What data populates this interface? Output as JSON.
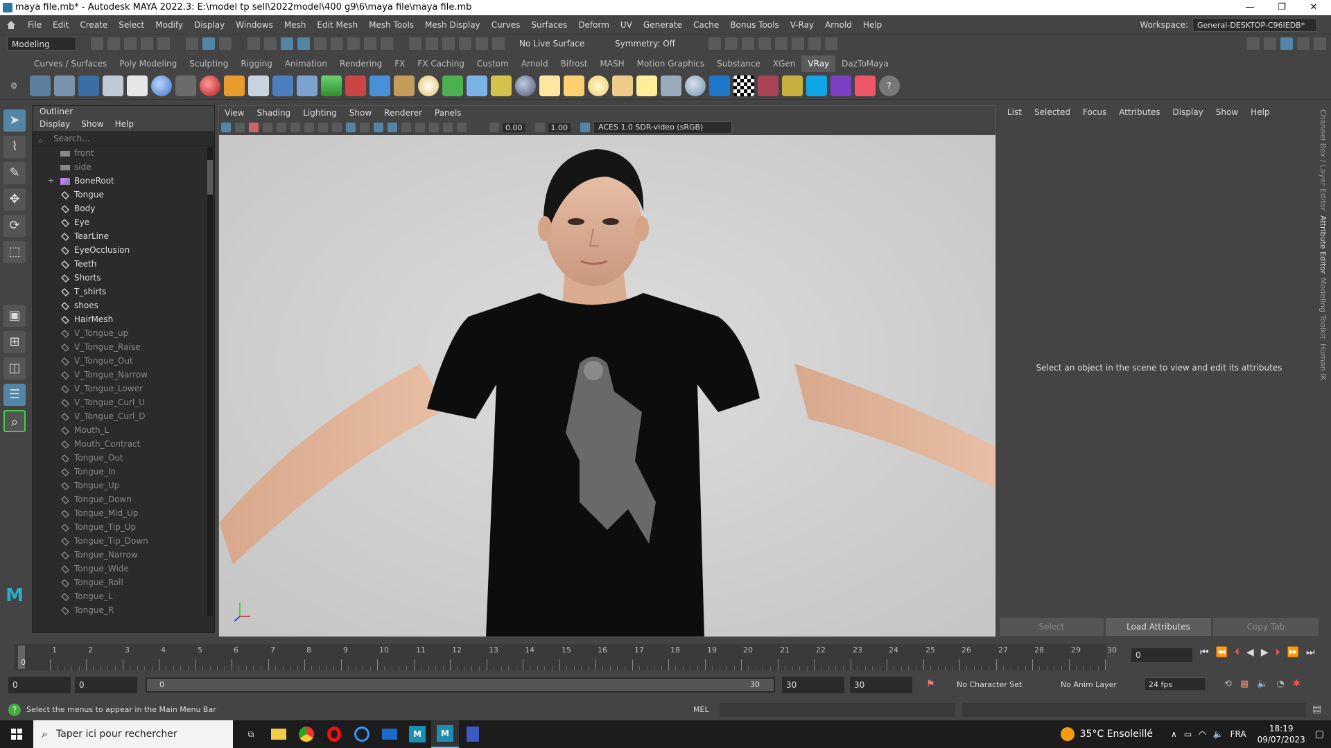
{
  "window": {
    "title": "maya file.mb* - Autodesk MAYA 2022.3: E:\\model tp sell\\2022model\\400 g9\\6\\maya file\\maya file.mb",
    "min": "—",
    "max": "❐",
    "close": "✕"
  },
  "menubar": {
    "items": [
      "File",
      "Edit",
      "Create",
      "Select",
      "Modify",
      "Display",
      "Windows",
      "Mesh",
      "Edit Mesh",
      "Mesh Tools",
      "Mesh Display",
      "Curves",
      "Surfaces",
      "Deform",
      "UV",
      "Generate",
      "Cache",
      "Bonus Tools",
      "V-Ray",
      "Arnold",
      "Help"
    ],
    "workspace_label": "Workspace:",
    "workspace_value": "General-DESKTOP-C96IEDB*"
  },
  "statusline": {
    "mode": "Modeling",
    "live_surface": "No Live Surface",
    "symmetry": "Symmetry: Off"
  },
  "shelf": {
    "tabs": [
      "Curves / Surfaces",
      "Poly Modeling",
      "Sculpting",
      "Rigging",
      "Animation",
      "Rendering",
      "FX",
      "FX Caching",
      "Custom",
      "Arnold",
      "Bifrost",
      "MASH",
      "Motion Graphics",
      "Substance",
      "XGen",
      "VRay",
      "DazToMaya"
    ],
    "active": "VRay"
  },
  "outliner": {
    "title": "Outliner",
    "menu": [
      "Display",
      "Show",
      "Help"
    ],
    "search_placeholder": "Search...",
    "items": [
      {
        "label": "front",
        "state": "off",
        "icon": "camera"
      },
      {
        "label": "side",
        "state": "off",
        "icon": "camera"
      },
      {
        "label": "BoneRoot",
        "state": "on",
        "icon": "joint",
        "expand": "+"
      },
      {
        "label": "Tongue",
        "state": "on",
        "icon": "mesh"
      },
      {
        "label": "Body",
        "state": "on",
        "icon": "mesh"
      },
      {
        "label": "Eye",
        "state": "on",
        "icon": "mesh"
      },
      {
        "label": "TearLine",
        "state": "on",
        "icon": "mesh"
      },
      {
        "label": "EyeOcclusion",
        "state": "on",
        "icon": "mesh"
      },
      {
        "label": "Teeth",
        "state": "on",
        "icon": "mesh"
      },
      {
        "label": "Shorts",
        "state": "on",
        "icon": "mesh"
      },
      {
        "label": "T_shirts",
        "state": "on",
        "icon": "mesh"
      },
      {
        "label": "shoes",
        "state": "on",
        "icon": "mesh"
      },
      {
        "label": "HairMesh",
        "state": "on",
        "icon": "mesh"
      },
      {
        "label": "V_Tongue_up",
        "state": "off",
        "icon": "mesh"
      },
      {
        "label": "V_Tongue_Raise",
        "state": "off",
        "icon": "mesh"
      },
      {
        "label": "V_Tongue_Out",
        "state": "off",
        "icon": "mesh"
      },
      {
        "label": "V_Tongue_Narrow",
        "state": "off",
        "icon": "mesh"
      },
      {
        "label": "V_Tongue_Lower",
        "state": "off",
        "icon": "mesh"
      },
      {
        "label": "V_Tongue_Curl_U",
        "state": "off",
        "icon": "mesh"
      },
      {
        "label": "V_Tongue_Curl_D",
        "state": "off",
        "icon": "mesh"
      },
      {
        "label": "Mouth_L",
        "state": "off",
        "icon": "mesh"
      },
      {
        "label": "Mouth_Contract",
        "state": "off",
        "icon": "mesh"
      },
      {
        "label": "Tongue_Out",
        "state": "off",
        "icon": "mesh"
      },
      {
        "label": "Tongue_In",
        "state": "off",
        "icon": "mesh"
      },
      {
        "label": "Tongue_Up",
        "state": "off",
        "icon": "mesh"
      },
      {
        "label": "Tongue_Down",
        "state": "off",
        "icon": "mesh"
      },
      {
        "label": "Tongue_Mid_Up",
        "state": "off",
        "icon": "mesh"
      },
      {
        "label": "Tongue_Tip_Up",
        "state": "off",
        "icon": "mesh"
      },
      {
        "label": "Tongue_Tip_Down",
        "state": "off",
        "icon": "mesh"
      },
      {
        "label": "Tongue_Narrow",
        "state": "off",
        "icon": "mesh"
      },
      {
        "label": "Tongue_Wide",
        "state": "off",
        "icon": "mesh"
      },
      {
        "label": "Tongue_Roll",
        "state": "off",
        "icon": "mesh"
      },
      {
        "label": "Tongue_L",
        "state": "off",
        "icon": "mesh"
      },
      {
        "label": "Tongue_R",
        "state": "off",
        "icon": "mesh"
      }
    ]
  },
  "viewport": {
    "menu": [
      "View",
      "Shading",
      "Lighting",
      "Show",
      "Renderer",
      "Panels"
    ],
    "exposure": "0.00",
    "gamma": "1.00",
    "colorspace": "ACES 1.0 SDR-video (sRGB)"
  },
  "attribute_editor": {
    "menu": [
      "List",
      "Selected",
      "Focus",
      "Attributes",
      "Display",
      "Show",
      "Help"
    ],
    "message": "Select an object in the scene to view and edit its attributes",
    "buttons": [
      "Select",
      "Load Attributes",
      "Copy Tab"
    ]
  },
  "side_tabs": [
    "Channel Box / Layer Editor",
    "Attribute Editor",
    "Modeling Toolkit",
    "Human IK"
  ],
  "timeline": {
    "ticks": [
      "1",
      "2",
      "3",
      "4",
      "5",
      "6",
      "7",
      "8",
      "9",
      "10",
      "11",
      "12",
      "13",
      "14",
      "15",
      "16",
      "17",
      "18",
      "19",
      "20",
      "21",
      "22",
      "23",
      "24",
      "25",
      "26",
      "27",
      "28",
      "29",
      "30"
    ],
    "start_label": "0",
    "current_frame": "0"
  },
  "rangebar": {
    "start": "0",
    "anim_start": "0",
    "range_start": "0",
    "range_end": "30",
    "anim_end": "30",
    "end": "30",
    "character_set": "No Character Set",
    "anim_layer": "No Anim Layer",
    "fps": "24 fps"
  },
  "cmdline": {
    "help": "Select the menus to appear in the Main Menu Bar",
    "lang": "MEL"
  },
  "taskbar": {
    "search": "Taper ici pour rechercher",
    "weather": "35°C Ensoleillé",
    "lang": "FRA",
    "time": "18:19",
    "date": "09/07/2023"
  }
}
